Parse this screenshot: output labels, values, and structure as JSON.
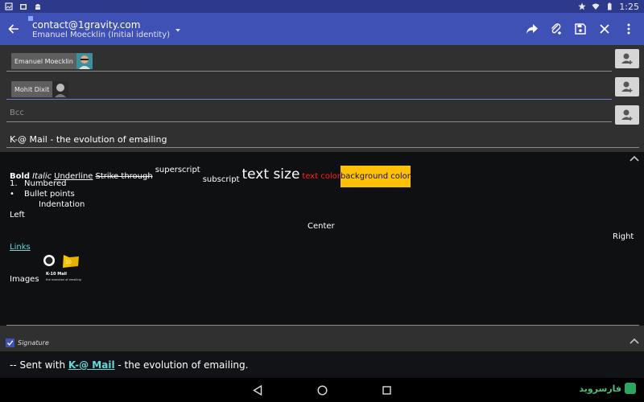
{
  "status_bar": {
    "time": "1:25",
    "icons": [
      "gallery-icon",
      "image-icon",
      "android-icon",
      "star-icon",
      "wifi-icon",
      "battery-icon"
    ]
  },
  "app_bar": {
    "account_email": "contact@1gravity.com",
    "identity_name": "Emanuel Moecklin (Initial identity)",
    "background_color": "#3f51b5",
    "actions": [
      "send-icon",
      "attach-icon",
      "save-icon",
      "close-icon",
      "overflow-icon"
    ]
  },
  "recipients": {
    "to": {
      "chip_label": "Emanuel Moecklin"
    },
    "cc": {
      "chip_label": "Mohit Dixit"
    },
    "bcc": {
      "placeholder": "Bcc"
    }
  },
  "subject": "K-@ Mail - the evolution of emailing",
  "editor": {
    "format_samples": {
      "bold": "Bold",
      "italic": "Italic",
      "underline": "Underline",
      "strike": "Strike through",
      "superscript": "superscript",
      "subscript": "subscript",
      "text_size": "text size",
      "text_color": "text color",
      "background_color": "background color"
    },
    "numbered_prefix": "1.",
    "numbered": "Numbered",
    "bullet_prefix": "•",
    "bullet": "Bullet points",
    "indentation": "Indentation",
    "left": "Left",
    "center": "Center",
    "right": "Right",
    "links": "Links",
    "images": "Images",
    "image_caption_title": "K-10 Mail",
    "image_caption_sub": "the evolution of emailing",
    "text_color_value": "#ff2020",
    "highlight_color_value": "#ffc107"
  },
  "signature": {
    "label": "Signature",
    "checked": true,
    "prefix": "-- Sent with ",
    "link_text": "K-@ Mail",
    "suffix": " - the evolution of emailing."
  },
  "watermark": "فارسروید"
}
